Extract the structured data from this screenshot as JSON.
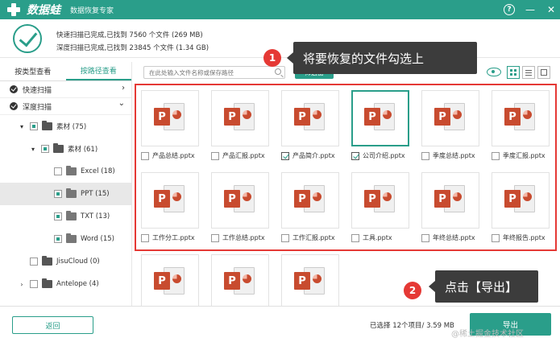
{
  "titlebar": {
    "app_name": "数据蛙",
    "app_subtitle": "数据恢复专家",
    "help_glyph": "?",
    "minimize_glyph": "—",
    "close_glyph": "✕"
  },
  "status": {
    "quick_scan": "快速扫描已完成,已找到 7560 个文件 (269 MB)",
    "deep_scan": "深度扫描已完成,已找到 23845 个文件 (1.34 GB)"
  },
  "left_panel": {
    "tabs": [
      {
        "label": "按类型查看",
        "active": false
      },
      {
        "label": "按路径查看",
        "active": true
      }
    ],
    "scan_modes": [
      {
        "label": "快速扫描",
        "chevron": "›"
      },
      {
        "label": "深度扫描",
        "chevron": "⌄"
      }
    ],
    "tree": [
      {
        "label": "素材 (75)"
      },
      {
        "label": "素材 (61)"
      },
      {
        "label": "Excel (18)"
      },
      {
        "label": "PPT (15)"
      },
      {
        "label": "TXT (13)"
      },
      {
        "label": "Word (15)"
      },
      {
        "label": "JisuCloud (0)"
      },
      {
        "label": "Antelope (4)"
      }
    ]
  },
  "toolbar": {
    "search_placeholder": "在此处输入文件名称或保存路径",
    "filter_label": "筛选器"
  },
  "files": [
    {
      "name": "产品总结.pptx",
      "checked": false
    },
    {
      "name": "产品汇报.pptx",
      "checked": false
    },
    {
      "name": "产品简介.pptx",
      "checked": true
    },
    {
      "name": "公司介绍.pptx",
      "checked": true
    },
    {
      "name": "季度总结.pptx",
      "checked": false
    },
    {
      "name": "季度汇报.pptx",
      "checked": false
    },
    {
      "name": "工作分工.pptx",
      "checked": false
    },
    {
      "name": "工作总结.pptx",
      "checked": false
    },
    {
      "name": "工作汇报.pptx",
      "checked": false
    },
    {
      "name": "工具.pptx",
      "checked": false
    },
    {
      "name": "年终总结.pptx",
      "checked": false
    },
    {
      "name": "年终报告.pptx",
      "checked": false
    },
    {
      "name": "",
      "checked": false
    },
    {
      "name": "",
      "checked": false
    },
    {
      "name": "",
      "checked": false
    }
  ],
  "ppt_letter": "P",
  "annotations": {
    "step1_number": "1",
    "step1_text": "将要恢复的文件勾选上",
    "step2_number": "2",
    "step2_text": "点击【导出】"
  },
  "footer": {
    "back_label": "返回",
    "selection_info": "已选择 12个项目/ 3.59 MB",
    "export_label": "导出"
  },
  "watermark": "@稀土掘金技术社区",
  "colors": {
    "accent": "#2a9e8a",
    "annotation_red": "#e53935",
    "ppt_red": "#c84b2f"
  }
}
